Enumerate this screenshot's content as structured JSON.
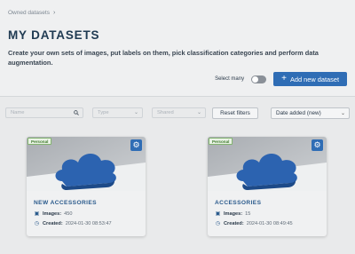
{
  "breadcrumb": {
    "label": "Owned datasets"
  },
  "page": {
    "title": "MY DATASETS",
    "description": "Create your own sets of images, put labels on them, pick classification categories and perform data augmentation."
  },
  "actions": {
    "select_many_label": "Select many",
    "select_many_on": false,
    "add_button_label": "Add new dataset"
  },
  "filters": {
    "name_placeholder": "Name",
    "type_placeholder": "Type",
    "shared_placeholder": "Shared",
    "reset_label": "Reset filters",
    "sort_value": "Date added (new)"
  },
  "colors": {
    "accent": "#2f6db5",
    "badge_green": "#3f7a2d",
    "cloud": "#2c63b0"
  },
  "datasets": [
    {
      "badge": "Personal",
      "name": "NEW ACCESSORIES",
      "images_label": "Images:",
      "images_value": "450",
      "created_label": "Created:",
      "created_value": "2024-01-30 08:53:47",
      "thumbnail_icon": "cloud-icon"
    },
    {
      "badge": "Personal",
      "name": "ACCESSORIES",
      "images_label": "Images:",
      "images_value": "15",
      "created_label": "Created:",
      "created_value": "2024-01-30 08:49:45",
      "thumbnail_icon": "cloud-icon"
    }
  ]
}
